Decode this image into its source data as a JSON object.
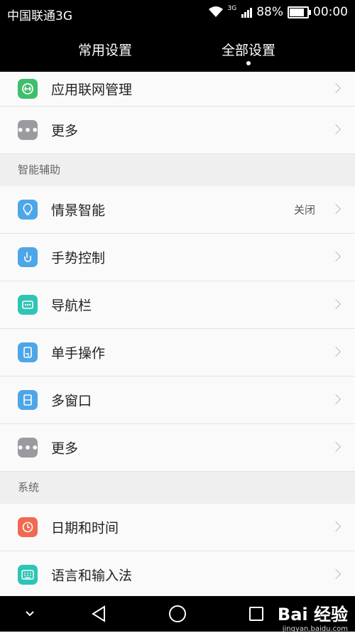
{
  "status_bar": {
    "carrier": "中国联通3G",
    "network": "3G",
    "battery": "88%",
    "time": "00:00"
  },
  "header": {
    "tabs": [
      {
        "label": "常用设置",
        "active": false
      },
      {
        "label": "全部设置",
        "active": true
      }
    ]
  },
  "settings": {
    "top_items": [
      {
        "label": "应用联网管理",
        "icon": "network-globe-icon",
        "color": "#3dbf6d"
      },
      {
        "label": "更多",
        "icon": "more-icon",
        "color": "#9a9aa0"
      }
    ],
    "sections": [
      {
        "title": "智能辅助",
        "items": [
          {
            "label": "情景智能",
            "value": "关闭",
            "icon": "lightbulb-icon",
            "color": "#4da6e8"
          },
          {
            "label": "手势控制",
            "icon": "hand-gesture-icon",
            "color": "#4da6e8"
          },
          {
            "label": "导航栏",
            "icon": "navigation-bar-icon",
            "color": "#2ec4b6"
          },
          {
            "label": "单手操作",
            "icon": "one-hand-icon",
            "color": "#4da6e8"
          },
          {
            "label": "多窗口",
            "icon": "multi-window-icon",
            "color": "#4da6e8"
          },
          {
            "label": "更多",
            "icon": "more-icon",
            "color": "#9a9aa0"
          }
        ]
      },
      {
        "title": "系统",
        "items": [
          {
            "label": "日期和时间",
            "icon": "clock-icon",
            "color": "#f06a4f"
          },
          {
            "label": "语言和输入法",
            "icon": "keyboard-icon",
            "color": "#2ec4b6"
          }
        ]
      }
    ]
  },
  "watermark": {
    "brand": "Bai 经验",
    "url": "jingyan.baidu.com"
  }
}
